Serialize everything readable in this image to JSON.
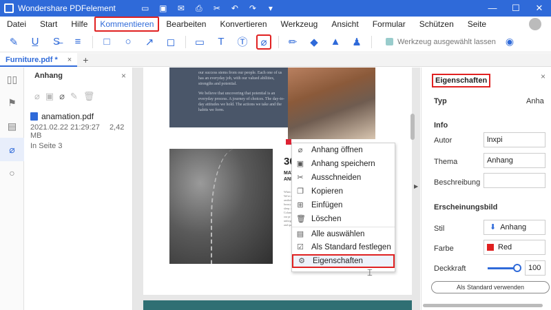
{
  "window": {
    "title": "Wondershare PDFelement",
    "controls": [
      "—",
      "☐",
      "✕"
    ]
  },
  "menu": [
    "Datei",
    "Start",
    "Hilfe",
    "Kommentieren",
    "Bearbeiten",
    "Konvertieren",
    "Werkzeug",
    "Ansicht",
    "Formular",
    "Schützen",
    "Seite"
  ],
  "toolbar": {
    "keep_tool_label": "Werkzeug ausgewählt lassen"
  },
  "tab": {
    "name": "Furniture.pdf *",
    "close": "×",
    "add": "+"
  },
  "attachments": {
    "title": "Anhang",
    "close": "×",
    "file": {
      "name": "anamation.pdf",
      "date": "2021.02.22 21:29:27",
      "size": "2,42 MB",
      "page": "In Seite 3"
    }
  },
  "page": {
    "dark_text": [
      "our success stems from our people. Each one of us has an everyday job, with our valued abilities, strengths and potential.",
      "We believe that uncovering that potential is an everyday process. A journey of choices. The day-to-day attitudes we hold. The actions we take and the habits we form."
    ],
    "heading_number": "30",
    "heading_lines": [
      "MATE",
      "AND T"
    ],
    "tiny_text": "When it co We're drawn aesthetic. luxury the sleep. An . At Colum with our pr unforgettab and qualit"
  },
  "context_menu": {
    "items": [
      {
        "label": "Anhang öffnen",
        "icon": "open-attachment-icon"
      },
      {
        "label": "Anhang speichern",
        "icon": "save-attachment-icon"
      },
      {
        "label": "Ausschneiden",
        "icon": "cut-icon"
      },
      {
        "label": "Kopieren",
        "icon": "copy-icon"
      },
      {
        "label": "Einfügen",
        "icon": "paste-icon"
      },
      {
        "label": "Löschen",
        "icon": "delete-icon"
      },
      {
        "label": "Alle auswählen",
        "icon": "select-all-icon"
      },
      {
        "label": "Als Standard festlegen",
        "icon": "set-default-icon"
      },
      {
        "label": "Eigenschaften",
        "icon": "properties-icon"
      }
    ]
  },
  "properties": {
    "title": "Eigenschaften",
    "typ_label": "Typ",
    "typ_value": "Anha",
    "info_label": "Info",
    "autor_label": "Autor",
    "autor_value": "lnxpi",
    "thema_label": "Thema",
    "thema_value": "Anhang",
    "beschreibung_label": "Beschreibung",
    "beschreibung_value": "",
    "appearance_label": "Erscheinungsbild",
    "stil_label": "Stil",
    "stil_value": "Anhang",
    "farbe_label": "Farbe",
    "farbe_value": "Red",
    "farbe_hex": "#e02020",
    "deckkraft_label": "Deckkraft",
    "deckkraft_value": "100",
    "default_button": "Als Standard verwenden"
  },
  "colors": {
    "accent": "#2f6ad9",
    "highlight": "#e02020"
  }
}
